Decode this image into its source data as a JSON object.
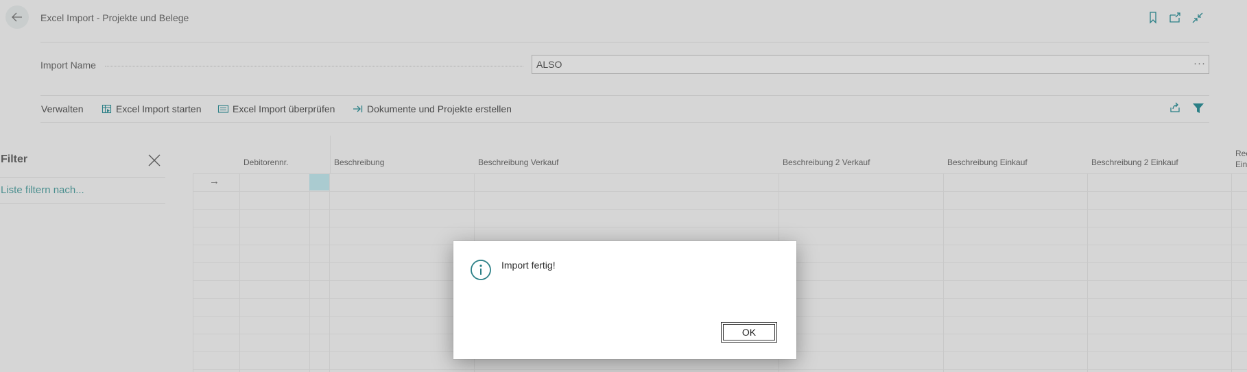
{
  "header": {
    "title": "Excel Import - Projekte und Belege",
    "icons": [
      "back-arrow-icon",
      "bookmark-icon",
      "open-new-window-icon",
      "collapse-icon"
    ]
  },
  "field": {
    "label": "Import Name",
    "value": "ALSO",
    "ellipsis": "···"
  },
  "actions": {
    "manage": "Verwalten",
    "start_import": "Excel Import starten",
    "check_import": "Excel Import überprüfen",
    "create_docs": "Dokumente und Projekte erstellen"
  },
  "filter_pane": {
    "title": "Filter",
    "link": "Liste filtern nach..."
  },
  "grid": {
    "columns": [
      "Debitorennr.",
      "Beschreibung",
      "Beschreibung Verkauf",
      "Beschreibung 2 Verkauf",
      "Beschreibung Einkauf",
      "Beschreibung 2 Einkauf",
      "Rec",
      "Ein"
    ],
    "row_marker": "→"
  },
  "dialog": {
    "message": "Import fertig!",
    "ok_label": "OK"
  },
  "colors": {
    "accent": "#2a7f86",
    "selection": "#aacbd0",
    "background": "#d6d6d6"
  }
}
